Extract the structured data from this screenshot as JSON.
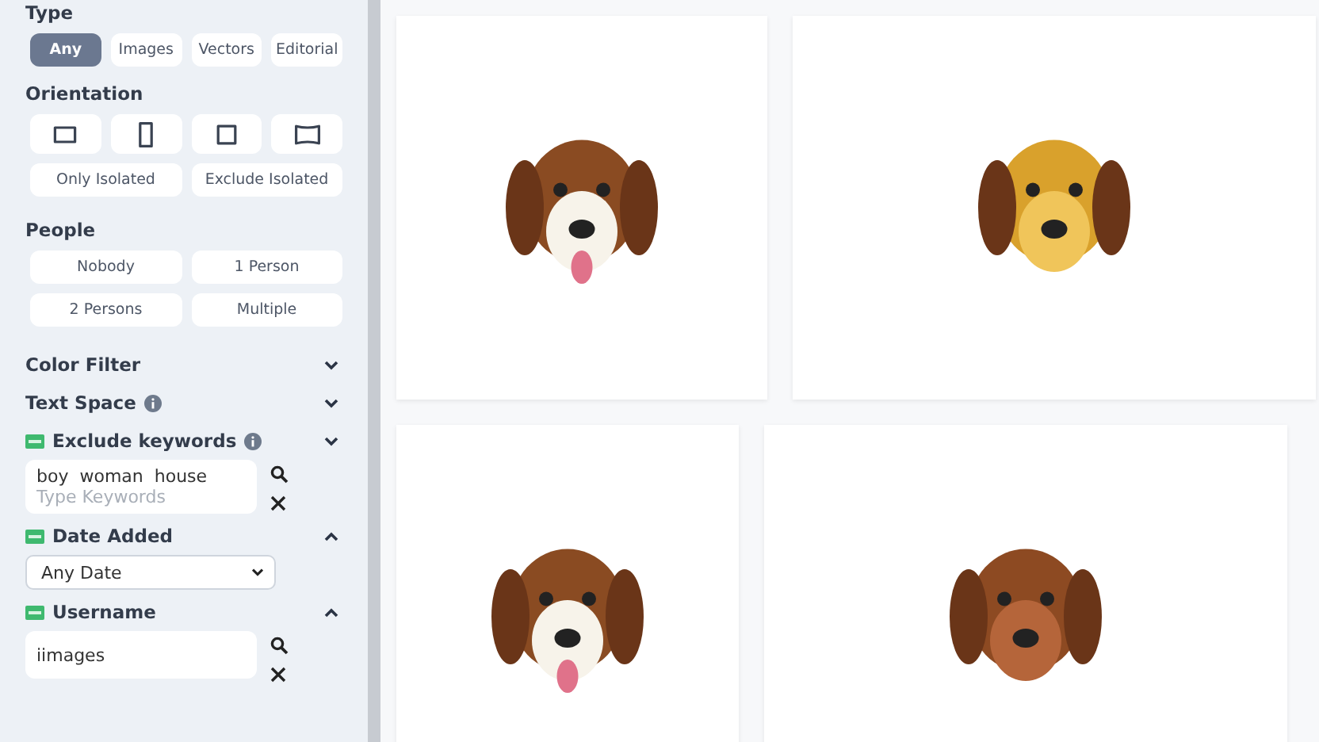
{
  "sidebar": {
    "type": {
      "title": "Type",
      "options": [
        {
          "label": "Any",
          "selected": true
        },
        {
          "label": "Images",
          "selected": false
        },
        {
          "label": "Vectors",
          "selected": false
        },
        {
          "label": "Editorial",
          "selected": false
        }
      ]
    },
    "orientation": {
      "title": "Orientation",
      "shapes": [
        {
          "kind": "landscape",
          "selected": false
        },
        {
          "kind": "portrait",
          "selected": false
        },
        {
          "kind": "square",
          "selected": false
        },
        {
          "kind": "panorama",
          "selected": false
        }
      ],
      "isolation": [
        {
          "label": "Only Isolated",
          "selected": false
        },
        {
          "label": "Exclude Isolated",
          "selected": false
        }
      ]
    },
    "people": {
      "title": "People",
      "options": [
        {
          "label": "Nobody",
          "selected": false
        },
        {
          "label": "1 Person",
          "selected": false
        },
        {
          "label": "2 Persons",
          "selected": false
        },
        {
          "label": "Multiple",
          "selected": false
        }
      ]
    },
    "sections": [
      {
        "kind": "plain",
        "title": "Color Filter",
        "info": false,
        "new": false,
        "expanded": false
      },
      {
        "kind": "plain",
        "title": "Text Space",
        "info": true,
        "new": false,
        "expanded": false
      },
      {
        "kind": "keywords",
        "title": "Exclude keywords",
        "info": true,
        "new": true,
        "expanded": false,
        "value": "boy  woman  house",
        "placeholder": "Type Keywords"
      },
      {
        "kind": "select",
        "title": "Date Added",
        "info": false,
        "new": true,
        "expanded": true,
        "value": "Any Date"
      },
      {
        "kind": "text",
        "title": "Username",
        "info": false,
        "new": true,
        "expanded": true,
        "value": "iimages"
      }
    ]
  },
  "results": {
    "images": [
      {
        "kind": "beagle"
      },
      {
        "kind": "fluffy"
      },
      {
        "kind": "beagle"
      },
      {
        "kind": "musical"
      }
    ]
  }
}
